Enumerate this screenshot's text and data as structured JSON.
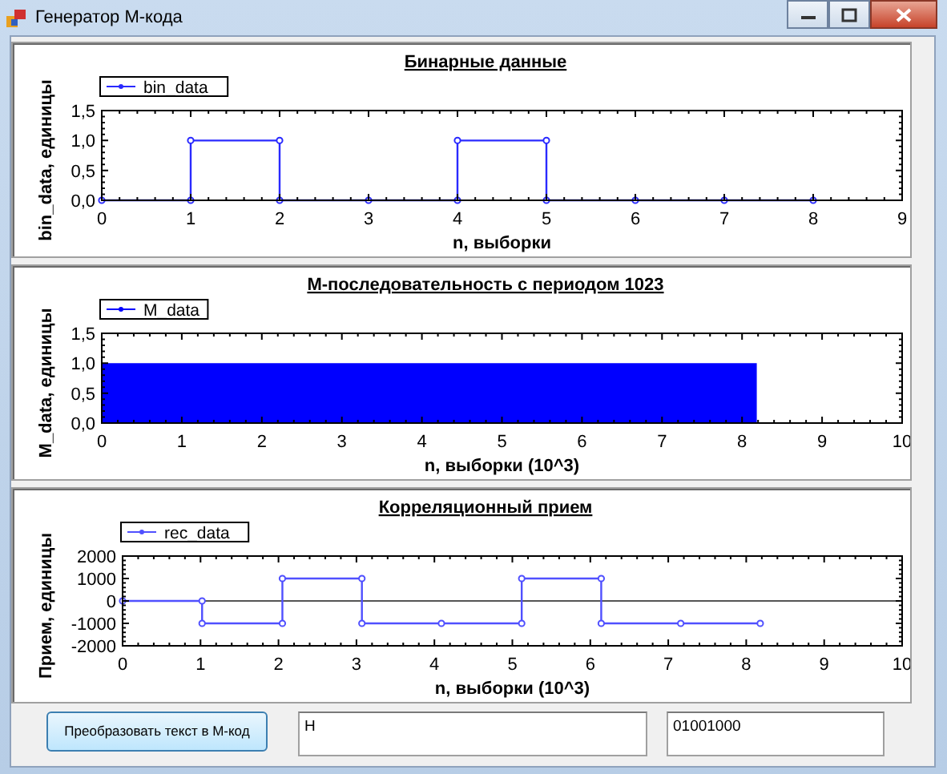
{
  "window": {
    "title": "Генератор М-кода"
  },
  "charts": [
    {
      "chart_data": {
        "type": "line",
        "title": "Бинарные данные",
        "xlabel": "n, выборки",
        "ylabel": "bin_data, единицы",
        "x": [
          0,
          1,
          1,
          2,
          2,
          3,
          4,
          4,
          5,
          5,
          6,
          7,
          8
        ],
        "series": [
          {
            "name": "bin_data",
            "color": "#2a2aff",
            "marker": "circle",
            "values": [
              0,
              0,
              1,
              1,
              0,
              0,
              0,
              1,
              1,
              0,
              0,
              0,
              0
            ]
          }
        ],
        "xlim": [
          0,
          9
        ],
        "ylim": [
          0,
          1.5
        ],
        "xticks": [
          0,
          1,
          2,
          3,
          4,
          5,
          6,
          7,
          8,
          9
        ],
        "yticks": [
          {
            "value": 0,
            "label": "0,0"
          },
          {
            "value": 0.5,
            "label": "0,5"
          },
          {
            "value": 1,
            "label": "1,0"
          },
          {
            "value": 1.5,
            "label": "1,5"
          }
        ]
      }
    },
    {
      "chart_data": {
        "type": "area",
        "title": "М-последовательность с периодом 1023",
        "xlabel": "n, выборки (10^3)",
        "ylabel": "M_data, единицы",
        "x": [
          0,
          8.184
        ],
        "series": [
          {
            "name": "M_data",
            "color": "#0000ff",
            "values": [
              1,
              1
            ]
          }
        ],
        "xlim": [
          0,
          10
        ],
        "ylim": [
          0,
          1.5
        ],
        "xticks": [
          0,
          1,
          2,
          3,
          4,
          5,
          6,
          7,
          8,
          9,
          10
        ],
        "yticks": [
          {
            "value": 0,
            "label": "0,0"
          },
          {
            "value": 0.5,
            "label": "0,5"
          },
          {
            "value": 1,
            "label": "1,0"
          },
          {
            "value": 1.5,
            "label": "1,5"
          }
        ]
      }
    },
    {
      "chart_data": {
        "type": "line",
        "title": "Корреляционный прием",
        "xlabel": "n, выборки (10^3)",
        "ylabel": "Прием, единицы",
        "x": [
          0,
          1.02,
          1.02,
          2.05,
          2.05,
          3.07,
          3.07,
          4.09,
          5.12,
          5.12,
          6.14,
          6.14,
          7.16,
          8.18
        ],
        "series": [
          {
            "name": "rec_data",
            "color": "#5050ff",
            "marker": "circle",
            "values": [
              0,
              0,
              -1000,
              -1000,
              1000,
              1000,
              -1000,
              -1000,
              -1000,
              1000,
              1000,
              -1000,
              -1000,
              -1000
            ]
          }
        ],
        "xlim": [
          0,
          10
        ],
        "ylim": [
          -2000,
          2000
        ],
        "xticks": [
          0,
          1,
          2,
          3,
          4,
          5,
          6,
          7,
          8,
          9,
          10
        ],
        "yticks": [
          -2000,
          -1000,
          0,
          1000,
          2000
        ]
      }
    }
  ],
  "button": {
    "label": "Преобразовать текст в М-код"
  },
  "input_text": {
    "value": "H"
  },
  "output_code": {
    "value": "01001000"
  }
}
